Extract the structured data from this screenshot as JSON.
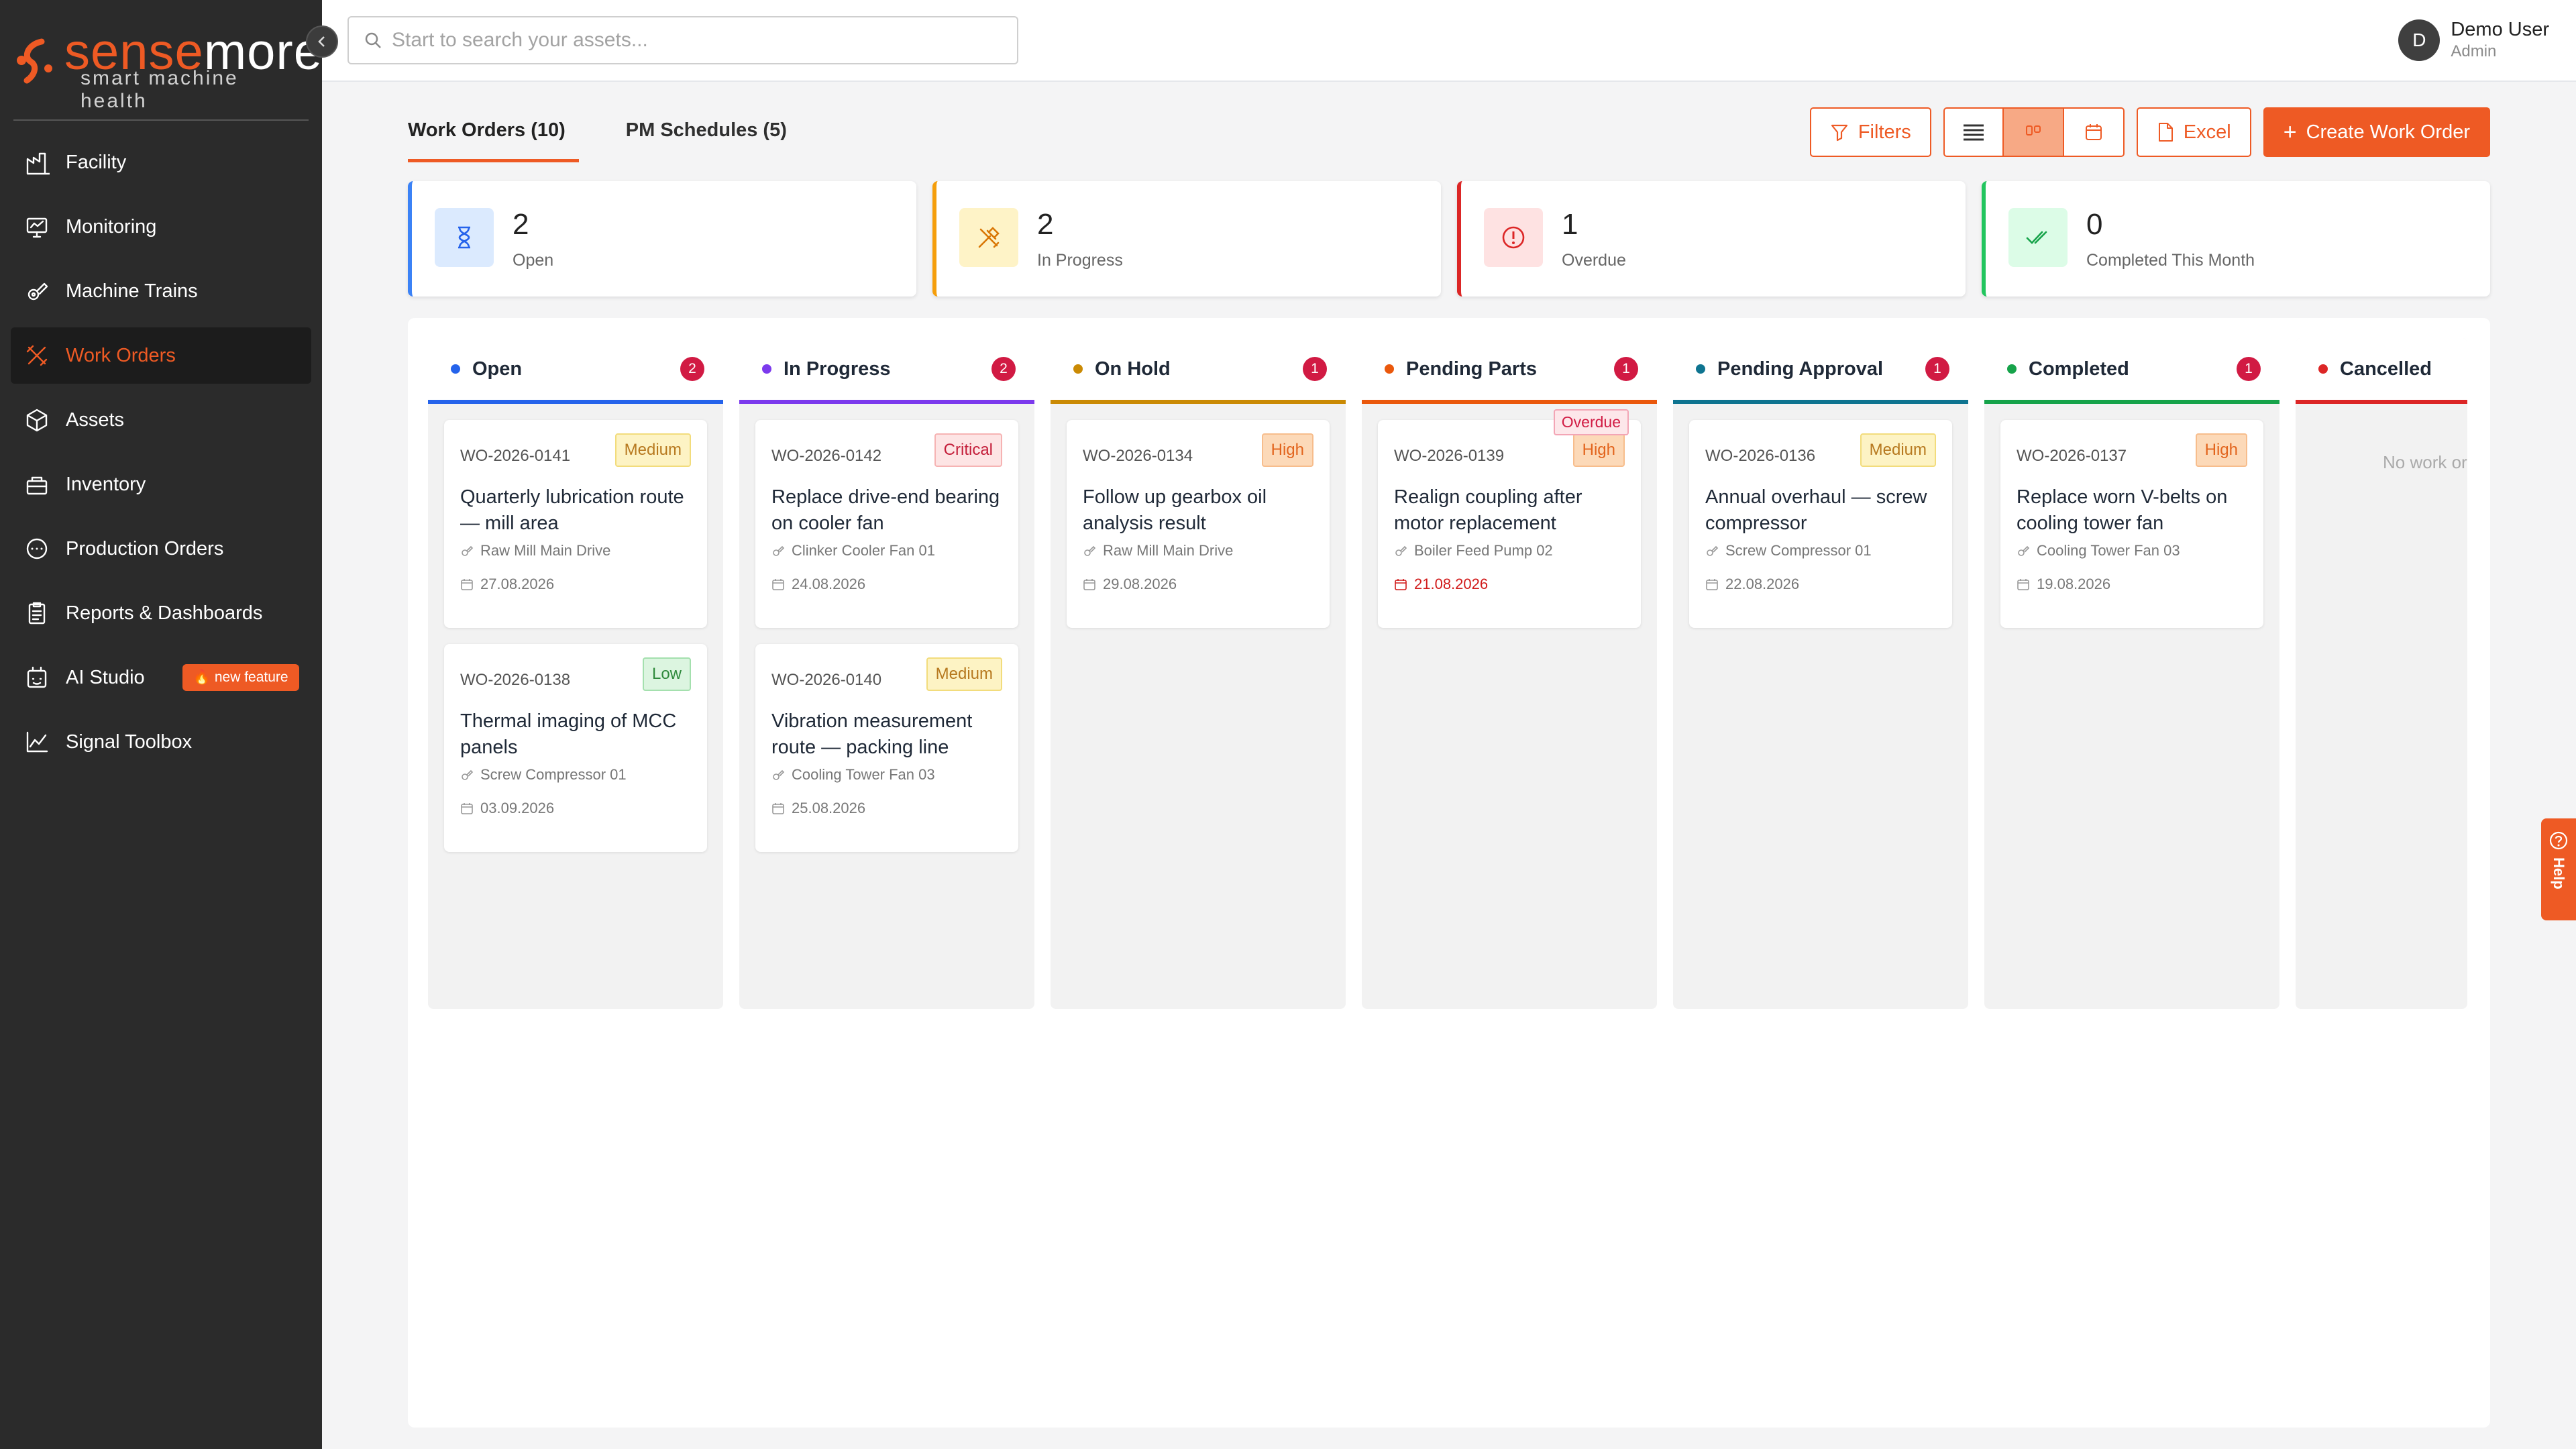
{
  "brand": {
    "name_part1": "sense",
    "name_part2": "more",
    "tagline": "smart machine health",
    "accent": "#ee5a24"
  },
  "sidebar": {
    "items": [
      {
        "label": "Facility",
        "icon": "facility-icon"
      },
      {
        "label": "Monitoring",
        "icon": "monitoring-icon"
      },
      {
        "label": "Machine Trains",
        "icon": "machine-trains-icon"
      },
      {
        "label": "Work Orders",
        "icon": "work-orders-icon",
        "active": true
      },
      {
        "label": "Assets",
        "icon": "assets-icon"
      },
      {
        "label": "Inventory",
        "icon": "inventory-icon"
      },
      {
        "label": "Production Orders",
        "icon": "production-orders-icon"
      },
      {
        "label": "Reports & Dashboards",
        "icon": "reports-icon"
      },
      {
        "label": "AI Studio",
        "icon": "ai-studio-icon",
        "badge": "new feature"
      },
      {
        "label": "Signal Toolbox",
        "icon": "signal-toolbox-icon"
      }
    ]
  },
  "search": {
    "placeholder": "Start to search your assets..."
  },
  "user": {
    "initial": "D",
    "name": "Demo User",
    "role": "Admin"
  },
  "tabs": [
    {
      "label": "Work Orders (10)",
      "active": true
    },
    {
      "label": "PM Schedules (5)",
      "active": false
    }
  ],
  "toolbar": {
    "filters": "Filters",
    "excel": "Excel",
    "create": "Create Work Order",
    "view_active": "board"
  },
  "stats": [
    {
      "value": "2",
      "label": "Open",
      "color": "#3b82f6"
    },
    {
      "value": "2",
      "label": "In Progress",
      "color": "#f59e0b"
    },
    {
      "value": "1",
      "label": "Overdue",
      "color": "#dc2626"
    },
    {
      "value": "0",
      "label": "Completed This Month",
      "color": "#22c55e"
    }
  ],
  "columns": [
    {
      "title": "Open",
      "count": "2",
      "color": "#2563eb",
      "cards": [
        {
          "id": "WO-2026-0141",
          "priority": "Medium",
          "title": "Quarterly lubrication route — mill area",
          "asset": "Raw Mill Main Drive",
          "date": "27.08.2026"
        },
        {
          "id": "WO-2026-0138",
          "priority": "Low",
          "title": "Thermal imaging of MCC panels",
          "asset": "Screw Compressor 01",
          "date": "03.09.2026"
        }
      ]
    },
    {
      "title": "In Progress",
      "count": "2",
      "color": "#7c3aed",
      "cards": [
        {
          "id": "WO-2026-0142",
          "priority": "Critical",
          "title": "Replace drive-end bearing on cooler fan",
          "asset": "Clinker Cooler Fan 01",
          "date": "24.08.2026"
        },
        {
          "id": "WO-2026-0140",
          "priority": "Medium",
          "title": "Vibration measurement route — packing line",
          "asset": "Cooling Tower Fan 03",
          "date": "25.08.2026"
        }
      ]
    },
    {
      "title": "On Hold",
      "count": "1",
      "color": "#ca8a04",
      "cards": [
        {
          "id": "WO-2026-0134",
          "priority": "High",
          "title": "Follow up gearbox oil analysis result",
          "asset": "Raw Mill Main Drive",
          "date": "29.08.2026"
        }
      ]
    },
    {
      "title": "Pending Parts",
      "count": "1",
      "color": "#ea580c",
      "cards": [
        {
          "id": "WO-2026-0139",
          "priority": "High",
          "overdue": "Overdue",
          "title": "Realign coupling after motor replacement",
          "asset": "Boiler Feed Pump 02",
          "date": "21.08.2026"
        }
      ]
    },
    {
      "title": "Pending Approval",
      "count": "1",
      "color": "#0e7490",
      "cards": [
        {
          "id": "WO-2026-0136",
          "priority": "Medium",
          "title": "Annual overhaul — screw compressor",
          "asset": "Screw Compressor 01",
          "date": "22.08.2026"
        }
      ]
    },
    {
      "title": "Completed",
      "count": "1",
      "color": "#16a34a",
      "cards": [
        {
          "id": "WO-2026-0137",
          "priority": "High",
          "title": "Replace worn V-belts on cooling tower fan",
          "asset": "Cooling Tower Fan 03",
          "date": "19.08.2026"
        }
      ]
    },
    {
      "title": "Cancelled",
      "count": "",
      "color": "#dc2626",
      "empty": "No work or",
      "cards": []
    }
  ],
  "help": {
    "label": "Help"
  }
}
